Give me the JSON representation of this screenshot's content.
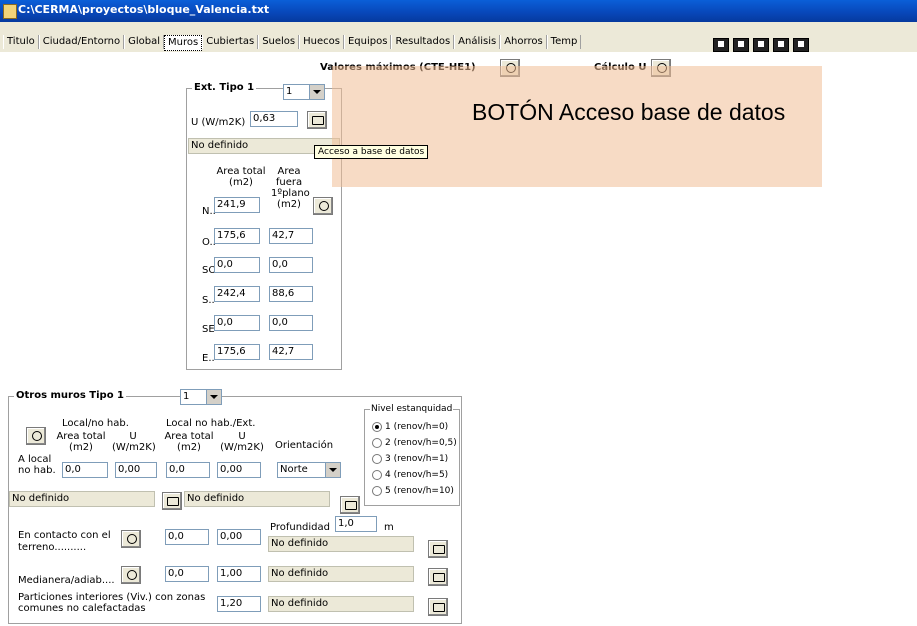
{
  "window": {
    "title": "C:\\CERMA\\proyectos\\bloque_Valencia.txt"
  },
  "tabs": [
    "Titulo",
    "Ciudad/Entorno",
    "Global",
    "Muros",
    "Cubiertas",
    "Suelos",
    "Huecos",
    "Equipos",
    "Resultados",
    "Análisis",
    "Ahorros",
    "Temp"
  ],
  "active_tab": "Muros",
  "header": {
    "valores_maximos": "Valores máximos (CTE-HE1)",
    "calculo_u": "Cálculo U"
  },
  "overlay": {
    "text": "BOTÓN Acceso base de datos"
  },
  "tooltip": {
    "text": "Acceso a base de datos"
  },
  "ext": {
    "legend": "Ext. Tipo 1",
    "type_value": "1",
    "u_label": "U (W/m2K)",
    "u_value": "0,63",
    "material": "No definido",
    "col_area_total": "Area total (m2)",
    "col_area_fuera": "Area fuera 1ºplano (m2)",
    "rows": [
      {
        "label": "N..",
        "total": "241,9",
        "fuera": ""
      },
      {
        "label": "O..",
        "total": "175,6",
        "fuera": "42,7"
      },
      {
        "label": "SO",
        "total": "0,0",
        "fuera": "0,0"
      },
      {
        "label": "S..",
        "total": "242,4",
        "fuera": "88,6"
      },
      {
        "label": "SE",
        "total": "0,0",
        "fuera": "0,0"
      },
      {
        "label": "E..",
        "total": "175,6",
        "fuera": "42,7"
      }
    ]
  },
  "otros": {
    "legend": "Otros muros Tipo 1",
    "type_value": "1",
    "local_nohab": "Local/no hab.",
    "local_nohab_ext": "Local no hab./Ext.",
    "area_total": "Area total (m2)",
    "u_wm2k": "U (W/m2K)",
    "orientacion_label": "Orientación",
    "a_local": "A local no hab.",
    "area_local": "0,0",
    "u_local": "0,00",
    "area_ext": "0,0",
    "u_ext": "0,00",
    "orientacion": "Norte",
    "mat1": "No definido",
    "mat2": "No definido",
    "profundidad_label": "Profundidad",
    "profundidad_value": "1,0",
    "profundidad_unit": "m",
    "terreno_label": "En contacto con el terreno..........",
    "terreno_area": "0,0",
    "terreno_u": "0,00",
    "terreno_mat": "No definido",
    "medianera_label": "Medianera/adiab....",
    "medianera_area": "0,0",
    "medianera_u": "1,00",
    "medianera_mat": "No definido",
    "particiones_label": "Particiones interiores (Viv.) con zonas comunes no calefactadas",
    "particiones_u": "1,20",
    "particiones_mat": "No definido",
    "nivel_legend": "Nivel estanquidad",
    "nivel_options": [
      "1 (renov/h=0)",
      "2 (renov/h=0,5)",
      "3 (renov/h=1)",
      "4 (renov/h=5)",
      "5 (renov/h=10)"
    ],
    "nivel_selected": 0
  }
}
